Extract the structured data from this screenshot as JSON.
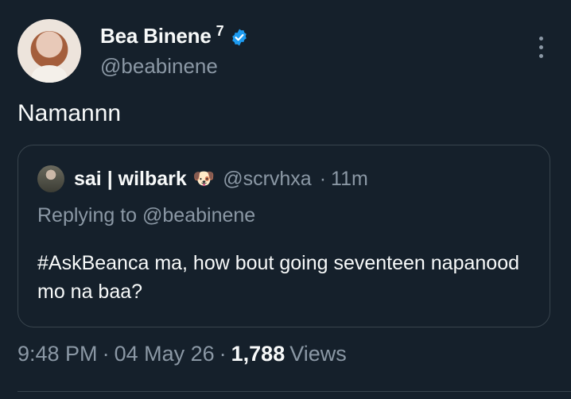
{
  "author": {
    "display_name": "Bea Binene",
    "superscript": "7",
    "handle": "@beabinene"
  },
  "tweet": {
    "text": "Namannn"
  },
  "quoted": {
    "display_name": "sai | wilbark",
    "emoji": "🐶",
    "handle": "@scrvhxa",
    "separator": "·",
    "time": "11m",
    "replying_to": "Replying to @beabinene",
    "body": "#AskBeanca ma, how bout going seventeen napanood mo na baa?"
  },
  "meta": {
    "time": "9:48 PM",
    "date": "04 May 26",
    "separator": "·",
    "views_count": "1,788",
    "views_label": "Views"
  },
  "colors": {
    "background": "#15202b",
    "text": "#f7f9f9",
    "muted": "#8b98a5",
    "verified": "#1d9bf0",
    "border": "#38444d"
  },
  "icons": [
    "verified-badge-icon",
    "more-options-icon",
    "dog-face-icon"
  ]
}
